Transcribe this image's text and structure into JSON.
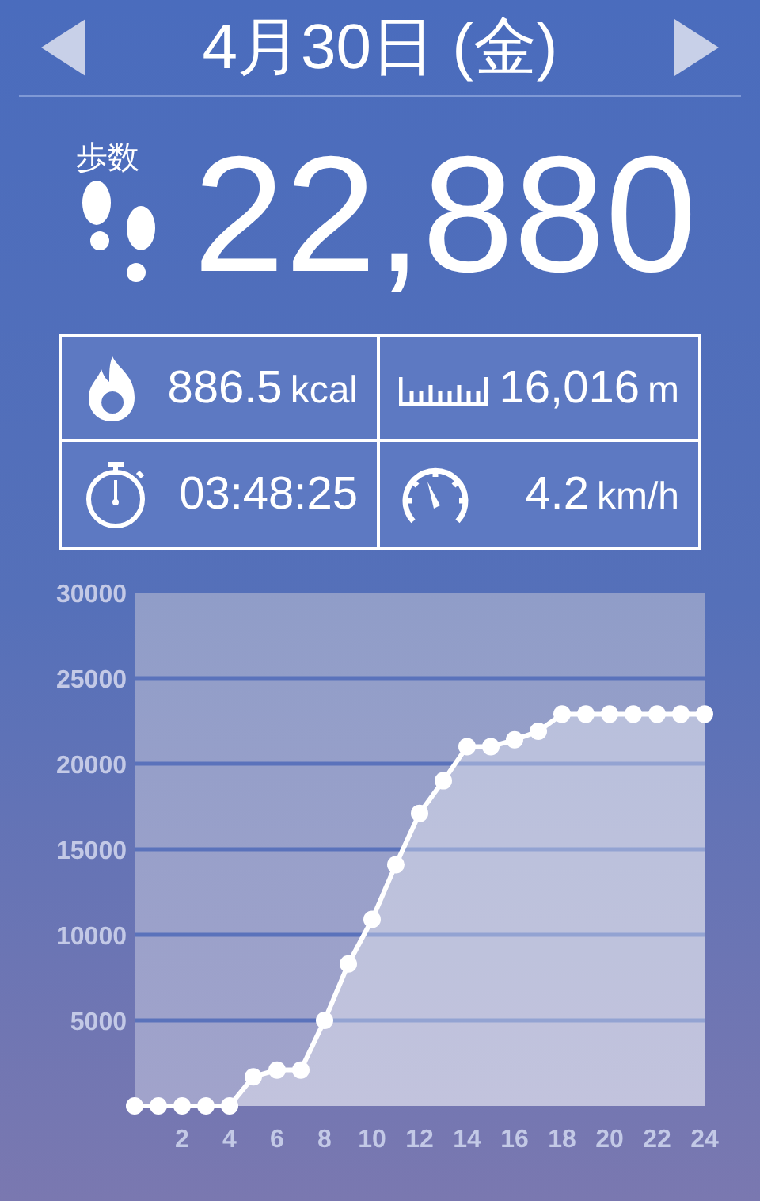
{
  "header": {
    "title": "4月30日 (金)"
  },
  "steps": {
    "label": "歩数",
    "value": "22,880"
  },
  "stats": [
    {
      "kind": "calories",
      "value": "886.5",
      "unit": "kcal"
    },
    {
      "kind": "distance",
      "value": "16,016",
      "unit": "m"
    },
    {
      "kind": "duration",
      "value": "03:48:25"
    },
    {
      "kind": "speed",
      "value": "4.2",
      "unit": "km/h"
    }
  ],
  "chart": {
    "chart_data": {
      "type": "area",
      "x": [
        0,
        1,
        2,
        3,
        4,
        5,
        6,
        7,
        8,
        9,
        10,
        11,
        12,
        13,
        14,
        15,
        16,
        17,
        18,
        19,
        20,
        21,
        22,
        23,
        24
      ],
      "series": [
        {
          "color": "#ffffff",
          "values": [
            0,
            0,
            0,
            0,
            0,
            1700,
            2100,
            2100,
            5000,
            8300,
            10900,
            14100,
            17100,
            19000,
            21000,
            21000,
            21400,
            21900,
            22900,
            22900,
            22900,
            22900,
            22900,
            22900,
            22900
          ]
        }
      ],
      "grid": true,
      "xlim": [
        0,
        24
      ],
      "ylim": [
        0,
        30000
      ],
      "xticks": [
        2,
        4,
        6,
        8,
        10,
        12,
        14,
        16,
        18,
        20,
        22,
        24
      ],
      "yticks": [
        5000,
        10000,
        15000,
        20000,
        25000,
        30000
      ]
    }
  }
}
